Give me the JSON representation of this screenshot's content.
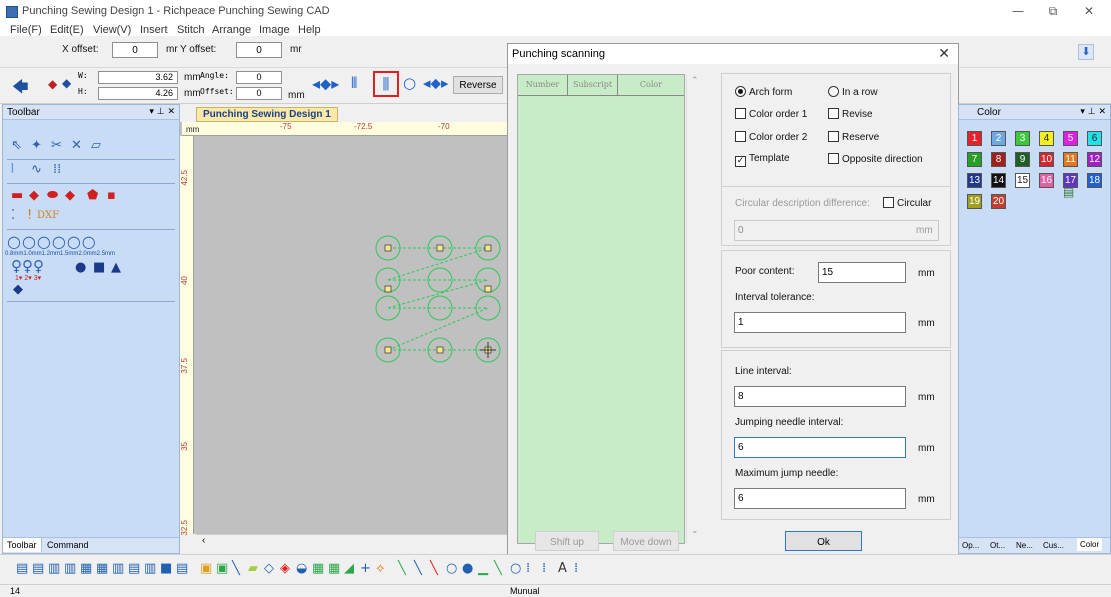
{
  "window": {
    "title": "Punching Sewing Design 1 - Richpeace Punching Sewing CAD",
    "minimize": "—",
    "restore": "⧉",
    "close": "✕"
  },
  "menu": [
    "File(F)",
    "Edit(E)",
    "View(V)",
    "Insert",
    "Stitch",
    "Arrange",
    "Image",
    "Help"
  ],
  "offsets": {
    "x_label": "X offset:",
    "x_value": "0",
    "x_unit": "mr",
    "y_label": "Y offset:",
    "y_value": "0",
    "y_unit": "mr"
  },
  "size": {
    "w_label": "W:",
    "w_value": "3.62",
    "h_label": "H:",
    "h_value": "4.26",
    "mm1": "mm",
    "angle_label": "Angle:",
    "angle_value": "0",
    "mm2": "mm",
    "offset_label": "Offset:",
    "offset_value": "0",
    "mm3": "mm",
    "reverse": "Reverse"
  },
  "left_panel": {
    "title": "Toolbar",
    "pin": "▾ ⊥ ✕",
    "sizes": "0.8mm1.0mm1.2mm1.5mm2.0mm2.5mm",
    "nums": "1▾  2▾  3▾",
    "dxf": "DXF",
    "tab1": "Toolbar",
    "tab2": "Command"
  },
  "document_tab": {
    "label": "Punching Sewing Design 1",
    "close": "x"
  },
  "ruler": {
    "unit": "mm",
    "top": [
      "-75",
      "-72.5",
      "-70"
    ],
    "left": [
      "42.5",
      "40",
      "37.5",
      "35",
      "32.5"
    ]
  },
  "dialog": {
    "title": "Punching scanning",
    "close": "✕",
    "list_headers": [
      "Number",
      "Subscript",
      "Color"
    ],
    "options": {
      "arch_form": "Arch form",
      "in_a_row": "In a row",
      "color_order_1": "Color order 1",
      "revise": "Revise",
      "color_order_2": "Color order 2",
      "reserve": "Reserve",
      "template": "Template",
      "opposite_direction": "Opposite direction",
      "arch_selected": true,
      "template_checked": true
    },
    "circular": {
      "label": "Circular description difference:",
      "checkbox": "Circular",
      "value": "0",
      "unit": "mm"
    },
    "poor_content": {
      "label": "Poor content:",
      "value": "15",
      "unit": "mm"
    },
    "interval_tolerance": {
      "label": "Interval tolerance:",
      "value": "1",
      "unit": "mm"
    },
    "line_interval": {
      "label": "Line interval:",
      "value": "8",
      "unit": "mm"
    },
    "jumping_needle": {
      "label": "Jumping needle interval:",
      "value": "6",
      "unit": "mm"
    },
    "max_jump": {
      "label": "Maximum jump needle:",
      "value": "6",
      "unit": "mm"
    },
    "shift_up": "Shift up",
    "move_down": "Move down",
    "ok": "Ok"
  },
  "color_panel": {
    "title": "Color",
    "pin": "▾ ⊥ ✕",
    "swatches": [
      {
        "n": "1",
        "bg": "#e8202a",
        "fg": "#ffffff"
      },
      {
        "n": "2",
        "bg": "#6ea8e0",
        "fg": "#ffffff"
      },
      {
        "n": "3",
        "bg": "#3cc83c",
        "fg": "#ffffff"
      },
      {
        "n": "4",
        "bg": "#f4f020",
        "fg": "#222222"
      },
      {
        "n": "5",
        "bg": "#e020e0",
        "fg": "#ffffff"
      },
      {
        "n": "6",
        "bg": "#20e0e8",
        "fg": "#222222"
      },
      {
        "n": "7",
        "bg": "#28a028",
        "fg": "#ffffff"
      },
      {
        "n": "8",
        "bg": "#a0201c",
        "fg": "#ffffff"
      },
      {
        "n": "9",
        "bg": "#206028",
        "fg": "#ffffff"
      },
      {
        "n": "10",
        "bg": "#d02830",
        "fg": "#ffffff"
      },
      {
        "n": "11",
        "bg": "#e07820",
        "fg": "#ffffff"
      },
      {
        "n": "12",
        "bg": "#a020c0",
        "fg": "#ffffff"
      },
      {
        "n": "13",
        "bg": "#203890",
        "fg": "#ffffff"
      },
      {
        "n": "14",
        "bg": "#111111",
        "fg": "#ffffff"
      },
      {
        "n": "15",
        "bg": "#ffffff",
        "fg": "#222222"
      },
      {
        "n": "16",
        "bg": "#e060a0",
        "fg": "#ffffff"
      },
      {
        "n": "17",
        "bg": "#6038c0",
        "fg": "#ffffff"
      },
      {
        "n": "18",
        "bg": "#2060d0",
        "fg": "#ffffff"
      },
      {
        "n": "19",
        "bg": "#a0a020",
        "fg": "#ffffff"
      },
      {
        "n": "20",
        "bg": "#c04030",
        "fg": "#ffffff"
      }
    ],
    "tabs": [
      "Op...",
      "Ot...",
      "Ne...",
      "Cus...",
      "Color"
    ]
  },
  "status": {
    "left": "14",
    "middle": "Munual"
  }
}
